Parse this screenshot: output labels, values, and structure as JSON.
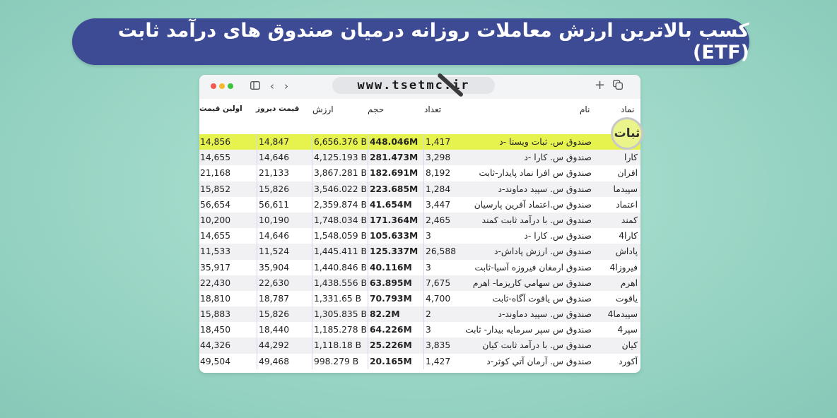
{
  "banner": {
    "title": "کسب بالاترین ارزش معاملات روزانه درمیان صندوق های درآمد ثابت (ETF)"
  },
  "browser": {
    "url": "www.tsetmc.ir"
  },
  "table": {
    "headers": {
      "first_price": "اولین قیمت",
      "prev_price": "قیمت دیروز",
      "value": "ارزش",
      "volume": "حجم",
      "count": "تعداد",
      "name": "نام",
      "symbol": "نماد"
    },
    "highlight_symbol": "ثبات",
    "rows": [
      {
        "first": "14,856",
        "prev": "14,847",
        "value": "6,656.376 B",
        "volume": "448.046M",
        "count": "1,417",
        "name": "صندوق س. ثبات ويستا -د",
        "symbol": ""
      },
      {
        "first": "14,655",
        "prev": "14,646",
        "value": "4,125.193 B",
        "volume": "281.473M",
        "count": "3,298",
        "name": "صندوق س. کارا -د",
        "symbol": "کارا"
      },
      {
        "first": "21,168",
        "prev": "21,133",
        "value": "3,867.281 B",
        "volume": "182.691M",
        "count": "8,192",
        "name": "صندوق س افرا نماد پايدار-ثابت",
        "symbol": "افران"
      },
      {
        "first": "15,852",
        "prev": "15,826",
        "value": "3,546.022 B",
        "volume": "223.685M",
        "count": "1,284",
        "name": "صندوق س. سپيد دماوند-د",
        "symbol": "سپيدما"
      },
      {
        "first": "56,654",
        "prev": "56,611",
        "value": "2,359.874 B",
        "volume": "41.654M",
        "count": "3,447",
        "name": "صندوق س.اعتماد آفرين پارسيان",
        "symbol": "اعتماد"
      },
      {
        "first": "10,200",
        "prev": "10,190",
        "value": "1,748.034 B",
        "volume": "171.364M",
        "count": "2,465",
        "name": "صندوق س. با درآمد ثابت کمند",
        "symbol": "کمند"
      },
      {
        "first": "14,655",
        "prev": "14,646",
        "value": "1,548.059 B",
        "volume": "105.633M",
        "count": "3",
        "name": "صندوق س. کارا -د",
        "symbol": "کارا4"
      },
      {
        "first": "11,533",
        "prev": "11,524",
        "value": "1,445.411 B",
        "volume": "125.337M",
        "count": "26,588",
        "name": "صندوق س. ارزش پاداش-د",
        "symbol": "پاداش"
      },
      {
        "first": "35,917",
        "prev": "35,904",
        "value": "1,440.846 B",
        "volume": "40.116M",
        "count": "3",
        "name": "صندوق ارمغان فيروزه آسيا-ثابت",
        "symbol": "فيروزا4"
      },
      {
        "first": "22,430",
        "prev": "22,630",
        "value": "1,438.556 B",
        "volume": "63.895M",
        "count": "7,675",
        "name": "صندوق س سهامي کاريزما- اهرم",
        "symbol": "اهرم"
      },
      {
        "first": "18,810",
        "prev": "18,787",
        "value": "1,331.65 B",
        "volume": "70.793M",
        "count": "4,700",
        "name": "صندوق س ياقوت آگاه-ثابت",
        "symbol": "ياقوت"
      },
      {
        "first": "15,883",
        "prev": "15,826",
        "value": "1,305.835 B",
        "volume": "82.2M",
        "count": "2",
        "name": "صندوق س. سپيد دماوند-د",
        "symbol": "سپيدما4"
      },
      {
        "first": "18,450",
        "prev": "18,440",
        "value": "1,185.278 B",
        "volume": "64.226M",
        "count": "3",
        "name": "صندوق س سپر سرمايه بيدار- ثابت",
        "symbol": "سپر4"
      },
      {
        "first": "44,326",
        "prev": "44,292",
        "value": "1,118.18 B",
        "volume": "25.226M",
        "count": "3,835",
        "name": "صندوق س. با درآمد ثابت کيان",
        "symbol": "کيان"
      },
      {
        "first": "49,504",
        "prev": "49,468",
        "value": "998.279 B",
        "volume": "20.165M",
        "count": "1,427",
        "name": "صندوق س. آرمان آتي کوثر-د",
        "symbol": "آکورد"
      }
    ]
  }
}
